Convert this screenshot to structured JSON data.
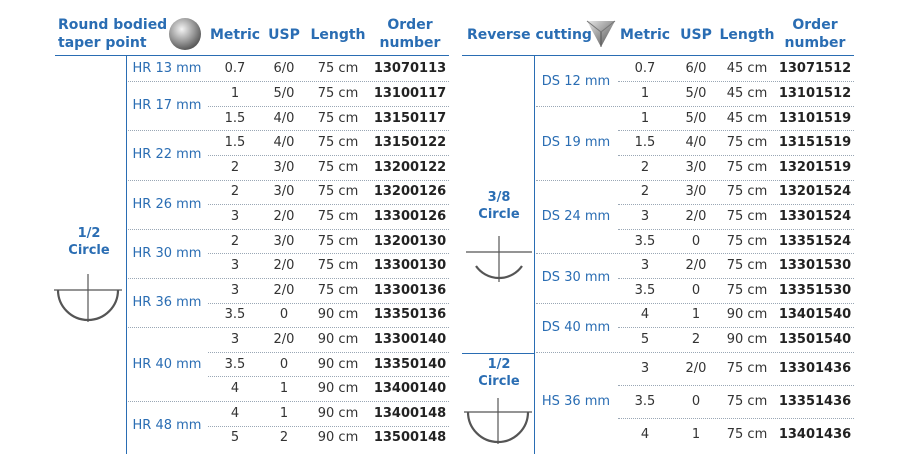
{
  "left": {
    "header": {
      "title_line1": "Round bodied",
      "title_line2": "taper point",
      "metric": "Metric",
      "usp": "USP",
      "length": "Length",
      "order_line1": "Order",
      "order_line2": "number"
    },
    "circle_label_line1": "1/2",
    "circle_label_line2": "Circle",
    "groups": [
      {
        "name": "HR 13 mm",
        "rows": [
          [
            "0.7",
            "6/0",
            "75 cm",
            "13070113"
          ]
        ]
      },
      {
        "name": "HR 17 mm",
        "rows": [
          [
            "1",
            "5/0",
            "75 cm",
            "13100117"
          ],
          [
            "1.5",
            "4/0",
            "75 cm",
            "13150117"
          ]
        ]
      },
      {
        "name": "HR 22 mm",
        "rows": [
          [
            "1.5",
            "4/0",
            "75 cm",
            "13150122"
          ],
          [
            "2",
            "3/0",
            "75 cm",
            "13200122"
          ]
        ]
      },
      {
        "name": "HR 26 mm",
        "rows": [
          [
            "2",
            "3/0",
            "75 cm",
            "13200126"
          ],
          [
            "3",
            "2/0",
            "75 cm",
            "13300126"
          ]
        ]
      },
      {
        "name": "HR 30 mm",
        "rows": [
          [
            "2",
            "3/0",
            "75 cm",
            "13200130"
          ],
          [
            "3",
            "2/0",
            "75 cm",
            "13300130"
          ]
        ]
      },
      {
        "name": "HR 36 mm",
        "rows": [
          [
            "3",
            "2/0",
            "75 cm",
            "13300136"
          ],
          [
            "3.5",
            "0",
            "90 cm",
            "13350136"
          ]
        ]
      },
      {
        "name": "HR 40 mm",
        "rows": [
          [
            "3",
            "2/0",
            "90 cm",
            "13300140"
          ],
          [
            "3.5",
            "0",
            "90 cm",
            "13350140"
          ],
          [
            "4",
            "1",
            "90 cm",
            "13400140"
          ]
        ]
      },
      {
        "name": "HR 48 mm",
        "rows": [
          [
            "4",
            "1",
            "90 cm",
            "13400148"
          ],
          [
            "5",
            "2",
            "90 cm",
            "13500148"
          ]
        ]
      }
    ]
  },
  "right": {
    "header": {
      "title": "Reverse cutting",
      "metric": "Metric",
      "usp": "USP",
      "length": "Length",
      "order_line1": "Order",
      "order_line2": "number"
    },
    "circle_a_line1": "3/8",
    "circle_a_line2": "Circle",
    "circle_b_line1": "1/2",
    "circle_b_line2": "Circle",
    "groups": [
      {
        "name": "DS 12 mm",
        "rows": [
          [
            "0.7",
            "6/0",
            "45 cm",
            "13071512"
          ],
          [
            "1",
            "5/0",
            "45 cm",
            "13101512"
          ]
        ]
      },
      {
        "name": "DS 19 mm",
        "rows": [
          [
            "1",
            "5/0",
            "45 cm",
            "13101519"
          ],
          [
            "1.5",
            "4/0",
            "75 cm",
            "13151519"
          ],
          [
            "2",
            "3/0",
            "75 cm",
            "13201519"
          ]
        ]
      },
      {
        "name": "DS 24 mm",
        "rows": [
          [
            "2",
            "3/0",
            "75 cm",
            "13201524"
          ],
          [
            "3",
            "2/0",
            "75 cm",
            "13301524"
          ],
          [
            "3.5",
            "0",
            "75 cm",
            "13351524"
          ]
        ]
      },
      {
        "name": "DS 30 mm",
        "rows": [
          [
            "3",
            "2/0",
            "75 cm",
            "13301530"
          ],
          [
            "3.5",
            "0",
            "75 cm",
            "13351530"
          ]
        ]
      },
      {
        "name": "DS 40 mm",
        "rows": [
          [
            "4",
            "1",
            "90 cm",
            "13401540"
          ],
          [
            "5",
            "2",
            "90 cm",
            "13501540"
          ]
        ]
      },
      {
        "name": "HS 36 mm",
        "rows": [
          [
            "3",
            "2/0",
            "75 cm",
            "13301436"
          ],
          [
            "3.5",
            "0",
            "75 cm",
            "13351436"
          ],
          [
            "4",
            "1",
            "75 cm",
            "13401436"
          ]
        ]
      }
    ]
  }
}
